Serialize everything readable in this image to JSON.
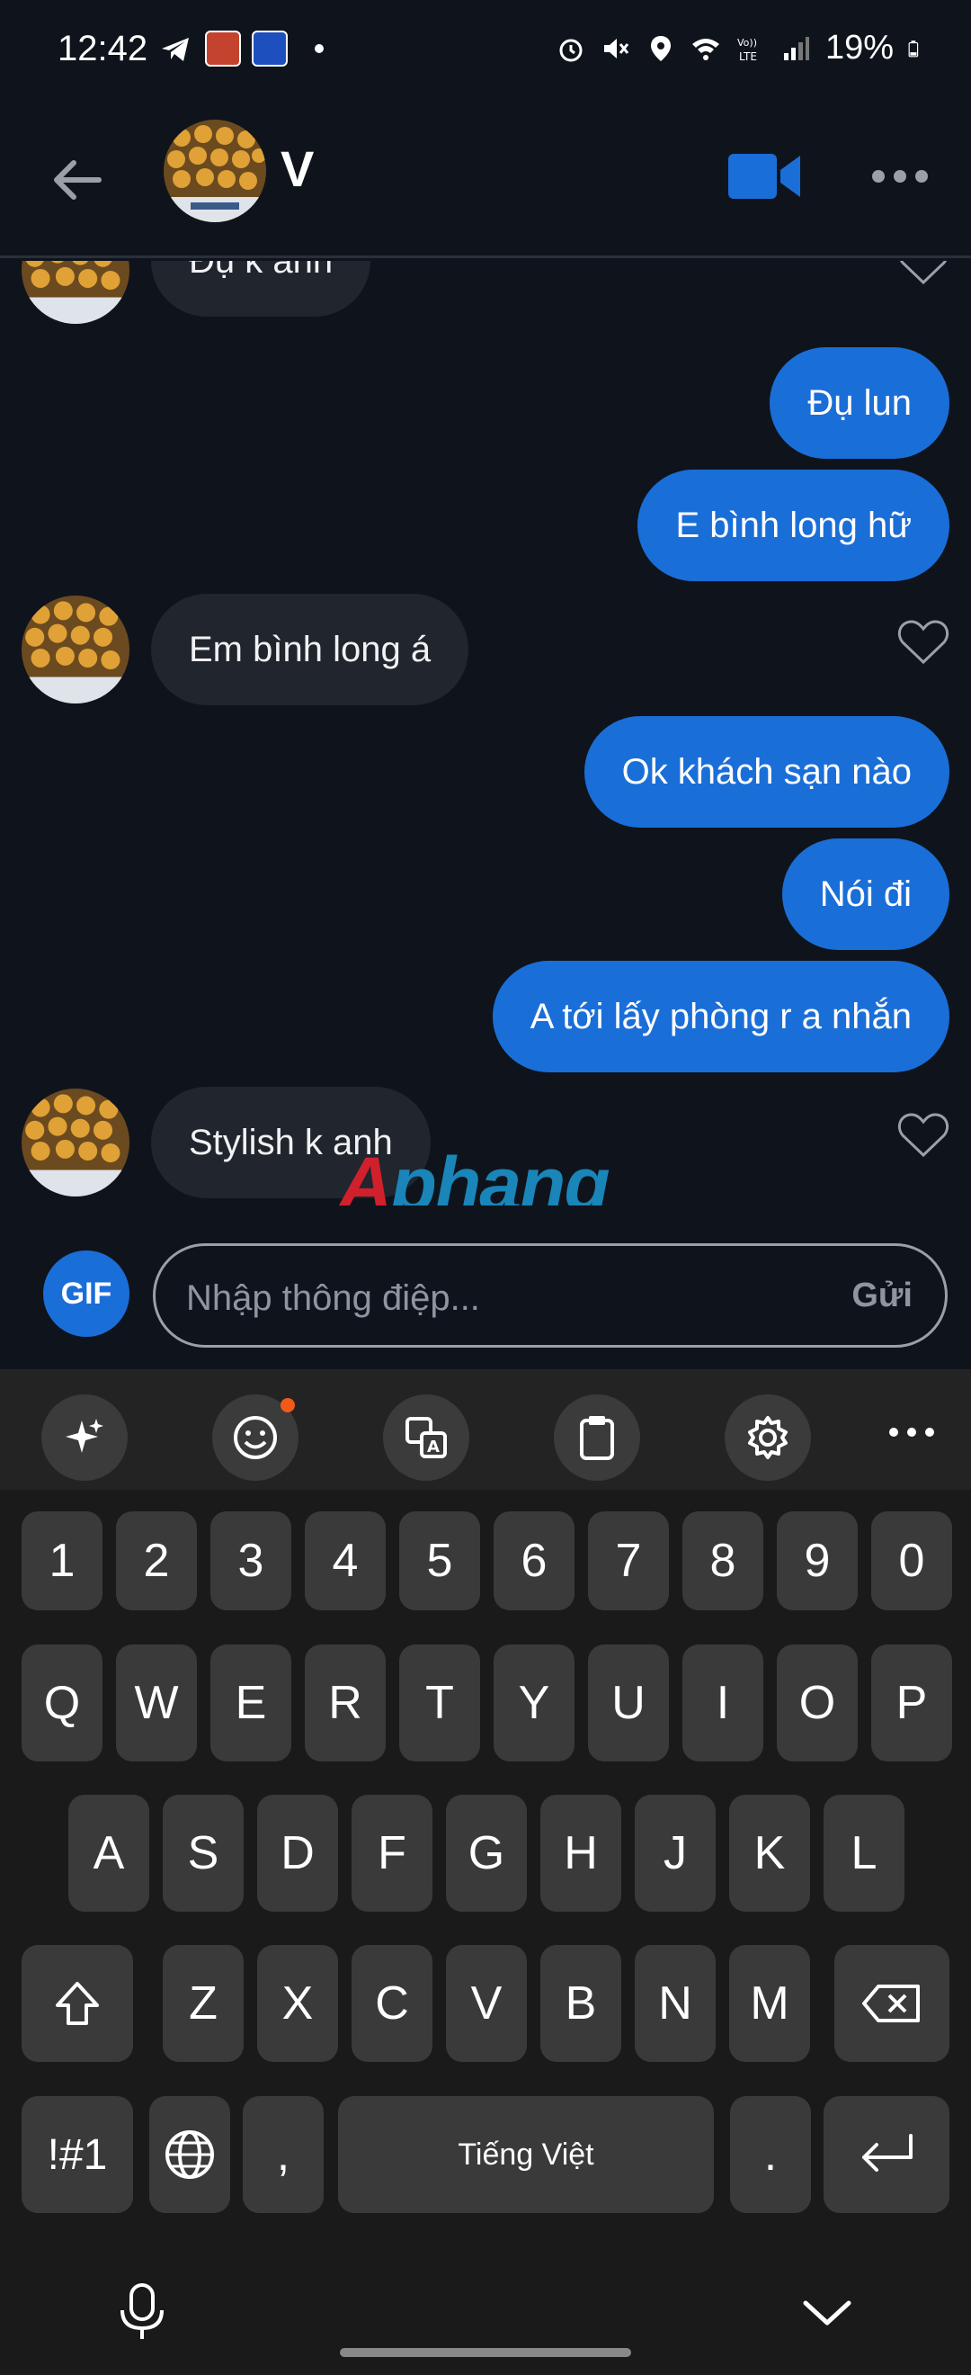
{
  "status_bar": {
    "time": "12:42",
    "battery": "19%",
    "icons": [
      "telegram-icon",
      "game-app-icon",
      "f8bet-app-icon",
      "alarm-icon",
      "mute-icon",
      "location-icon",
      "wifi-icon",
      "volte-icon",
      "signal-icon",
      "battery-icon"
    ]
  },
  "header": {
    "contact_name": "V",
    "accent": "#1a6ed8"
  },
  "messages": [
    {
      "side": "in",
      "text": "Đụ k anh"
    },
    {
      "side": "out",
      "text": "Đụ lun"
    },
    {
      "side": "out",
      "text": "E bình long hữ"
    },
    {
      "side": "in",
      "text": "Em bình long á"
    },
    {
      "side": "out",
      "text": "Ok khách sạn nào"
    },
    {
      "side": "out",
      "text": "Nói đi"
    },
    {
      "side": "out",
      "text": "A tới lấy phòng r a nhắn"
    },
    {
      "side": "in",
      "text": "Stylish k anh"
    }
  ],
  "watermark": {
    "first": "A",
    "rest": "phang"
  },
  "compose": {
    "gif_label": "GIF",
    "placeholder": "Nhập thông điệp...",
    "send_label": "Gửi"
  },
  "keyboard": {
    "number_row": [
      "1",
      "2",
      "3",
      "4",
      "5",
      "6",
      "7",
      "8",
      "9",
      "0"
    ],
    "row1": [
      "Q",
      "W",
      "E",
      "R",
      "T",
      "Y",
      "U",
      "I",
      "O",
      "P"
    ],
    "row2": [
      "A",
      "S",
      "D",
      "F",
      "G",
      "H",
      "J",
      "K",
      "L"
    ],
    "row3": [
      "Z",
      "X",
      "C",
      "V",
      "B",
      "N",
      "M"
    ],
    "symbols_label": "!#1",
    "comma": ",",
    "space_label": "Tiếng Việt",
    "period": ".",
    "toolbar_icons": [
      "ai-sparkle-icon",
      "emoji-icon",
      "translate-icon",
      "clipboard-icon",
      "settings-icon",
      "more-icon"
    ]
  }
}
